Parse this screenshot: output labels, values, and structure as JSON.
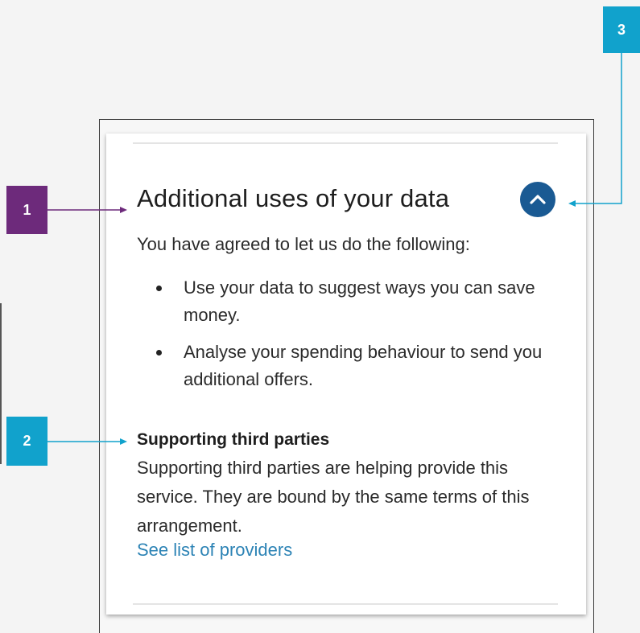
{
  "callouts": [
    {
      "number": "1",
      "color": "#6d2a7b"
    },
    {
      "number": "2",
      "color": "#11a2cc"
    },
    {
      "number": "3",
      "color": "#11a2cc"
    }
  ],
  "card": {
    "title": "Additional uses of your data",
    "toggle_icon": "chevron-up-icon",
    "toggle_color": "#1a5a93",
    "intro": "You have agreed to let us do the following:",
    "uses": [
      "Use your data to suggest ways you can save money.",
      "Analyse your spending behaviour to send you additional offers."
    ],
    "third_parties": {
      "heading": "Supporting third parties",
      "body": "Supporting third parties are helping provide this service. They are bound by the same terms of this arrangement.",
      "link_label": "See list of providers",
      "link_color": "#2c83b5"
    }
  }
}
